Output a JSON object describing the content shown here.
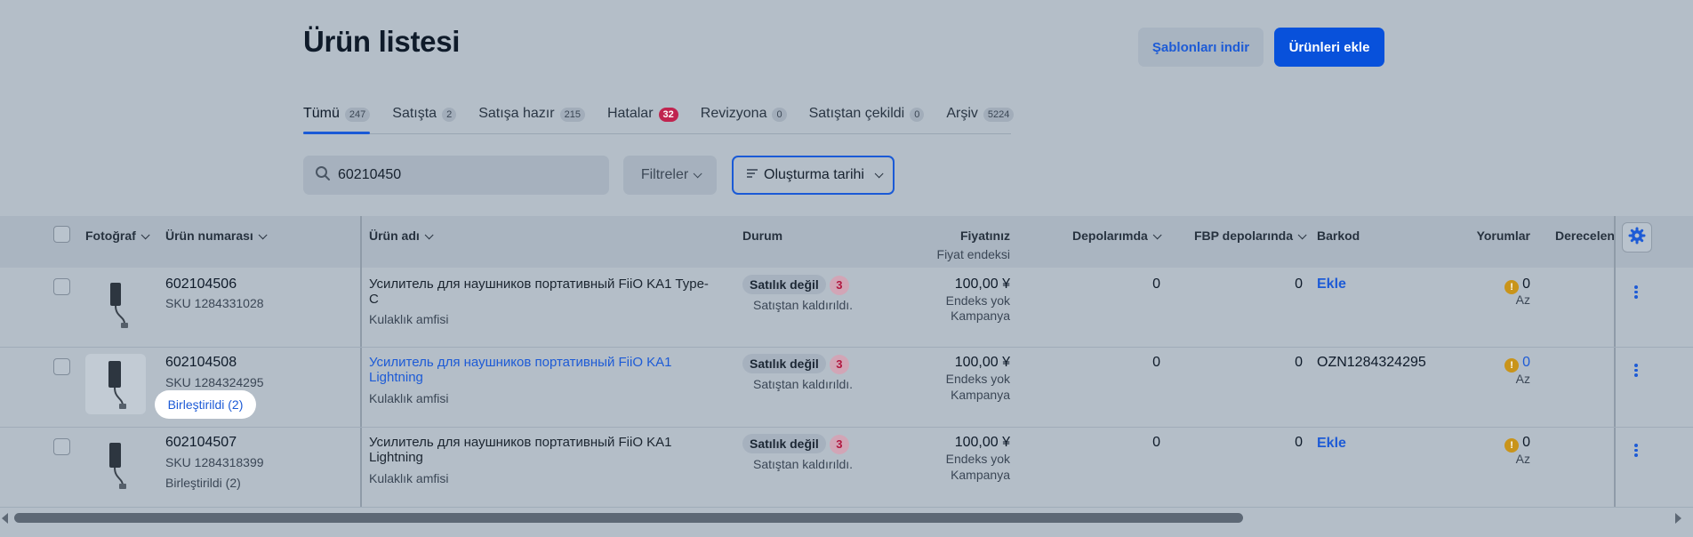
{
  "header": {
    "title": "Ürün listesi",
    "templates_button": "Şablonları indir",
    "add_button": "Ürünleri ekle"
  },
  "tabs": [
    {
      "label": "Tümü",
      "count": "247",
      "active": true
    },
    {
      "label": "Satışta",
      "count": "2"
    },
    {
      "label": "Satışa hazır",
      "count": "215"
    },
    {
      "label": "Hatalar",
      "count": "32",
      "error": true
    },
    {
      "label": "Revizyona",
      "count": "0"
    },
    {
      "label": "Satıştan çekildi",
      "count": "0"
    },
    {
      "label": "Arşiv",
      "count": "5224"
    }
  ],
  "search": {
    "value": "60210450"
  },
  "filters_label": "Filtreler",
  "sort_label": "Oluşturma tarihi",
  "columns": {
    "photo": "Fotoğraf",
    "product_number": "Ürün numarası",
    "product_name": "Ürün adı",
    "status": "Durum",
    "price": "Fiyatınız",
    "price_sub": "Fiyat endeksi",
    "warehouses": "Depolarımda",
    "fbp": "FBP depolarında",
    "barcode": "Barkod",
    "reviews": "Yorumlar",
    "rating": "Derecelen"
  },
  "rows": [
    {
      "number": "602104506",
      "sku": "SKU 1284331028",
      "merged": "",
      "name_line1": "Усилитель для наушников портативный FiiO KA1 Type-",
      "name_line2": "C",
      "category": "Kulaklık amfisi",
      "status": "Satılık değil",
      "status_count": "3",
      "status_note": "Satıştan kaldırıldı.",
      "price": "100,00 ¥",
      "index": "Endeks yok",
      "campaign": "Kampanya",
      "warehouses": "0",
      "fbp": "0",
      "barcode": "Ekle",
      "reviews": "0",
      "reviews_note": "Az"
    },
    {
      "number": "602104508",
      "sku": "SKU 1284324295",
      "merged": "Birleştirildi (2)",
      "name_line1": "Усилитель для наушников портативный FiiO KA1",
      "name_line2": "Lightning",
      "category": "Kulaklık amfisi",
      "status": "Satılık değil",
      "status_count": "3",
      "status_note": "Satıştan kaldırıldı.",
      "price": "100,00 ¥",
      "index": "Endeks yok",
      "campaign": "Kampanya",
      "warehouses": "0",
      "fbp": "0",
      "barcode": "OZN1284324295",
      "reviews": "0",
      "reviews_note": "Az"
    },
    {
      "number": "602104507",
      "sku": "SKU 1284318399",
      "merged": "Birleştirildi (2)",
      "name_line1": "Усилитель для наушников портативный FiiO KA1",
      "name_line2": "Lightning",
      "category": "Kulaklık amfisi",
      "status": "Satılık değil",
      "status_count": "3",
      "status_note": "Satıştan kaldırıldı.",
      "price": "100,00 ¥",
      "index": "Endeks yok",
      "campaign": "Kampanya",
      "warehouses": "0",
      "fbp": "0",
      "barcode": "Ekle",
      "reviews": "0",
      "reviews_note": "Az"
    }
  ],
  "colors": {
    "accent": "#0851db",
    "link": "#1d5bd6",
    "error": "#c0244f",
    "warn": "#c9941a"
  }
}
